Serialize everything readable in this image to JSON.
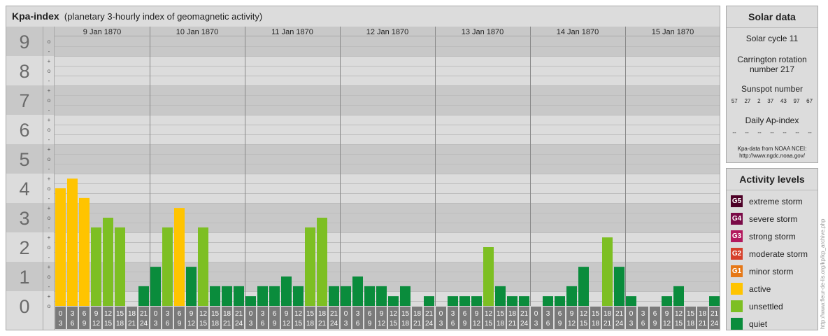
{
  "header": {
    "title": "Kpa-index",
    "subtitle": "(planetary 3-hourly index of geomagnetic activity)"
  },
  "chart_data": {
    "type": "bar",
    "title": "Kpa-index",
    "ylim": [
      0,
      9
    ],
    "y_tick_labels": [
      "0",
      "1",
      "2",
      "3",
      "4",
      "5",
      "6",
      "7",
      "8",
      "9"
    ],
    "y_sub_labels": [
      "+",
      "o",
      "-"
    ],
    "days": [
      "9 Jan 1870",
      "10 Jan 1870",
      "11 Jan 1870",
      "12 Jan 1870",
      "13 Jan 1870",
      "14 Jan 1870",
      "15 Jan 1870"
    ],
    "interval_start_labels": [
      "0",
      "3",
      "6",
      "9",
      "12",
      "15",
      "18",
      "21"
    ],
    "interval_end_labels": [
      "3",
      "6",
      "9",
      "12",
      "15",
      "18",
      "21",
      "24"
    ],
    "values": [
      [
        4.0,
        4.33,
        3.67,
        2.67,
        3.0,
        2.67,
        0.0,
        0.67
      ],
      [
        1.33,
        2.67,
        3.33,
        1.33,
        2.67,
        0.67,
        0.67,
        0.67
      ],
      [
        0.33,
        0.67,
        0.67,
        1.0,
        0.67,
        2.67,
        3.0,
        0.67
      ],
      [
        0.67,
        1.0,
        0.67,
        0.67,
        0.33,
        0.67,
        0.0,
        0.33
      ],
      [
        0.0,
        0.33,
        0.33,
        0.33,
        2.0,
        0.67,
        0.33,
        0.33
      ],
      [
        0.0,
        0.33,
        0.33,
        0.67,
        1.33,
        0.0,
        2.33,
        1.33
      ],
      [
        0.33,
        0.0,
        0.0,
        0.33,
        0.67,
        0.0,
        0.0,
        0.33
      ]
    ],
    "grid": true
  },
  "solar": {
    "title": "Solar data",
    "cycle": "Solar cycle 11",
    "carrington": "Carrington rotation number 217",
    "sunspot_label": "Sunspot number",
    "sunspots": [
      "57",
      "27",
      "2",
      "37",
      "43",
      "97",
      "67"
    ],
    "ap_label": "Daily Ap-index",
    "ap_values": [
      "--",
      "--",
      "--",
      "--",
      "--",
      "--",
      "--"
    ],
    "credit_line1": "Kpa-data from NOAA NCEI:",
    "credit_line2": "http://www.ngdc.noaa.gov/"
  },
  "activity": {
    "title": "Activity levels",
    "items": [
      {
        "code": "G5",
        "label": "extreme storm",
        "color": "#4d0026"
      },
      {
        "code": "G4",
        "label": "severe storm",
        "color": "#7a0a47"
      },
      {
        "code": "G3",
        "label": "strong storm",
        "color": "#b3195e"
      },
      {
        "code": "G2",
        "label": "moderate storm",
        "color": "#d6402a"
      },
      {
        "code": "G1",
        "label": "minor storm",
        "color": "#e67817"
      },
      {
        "code": "",
        "label": "active",
        "color": "#ffc400"
      },
      {
        "code": "",
        "label": "unsettled",
        "color": "#7dbf23"
      },
      {
        "code": "",
        "label": "quiet",
        "color": "#0a8c3c"
      }
    ]
  },
  "watermark": "http://www.fleur-de-lis.org/kp/kp_archive.php"
}
